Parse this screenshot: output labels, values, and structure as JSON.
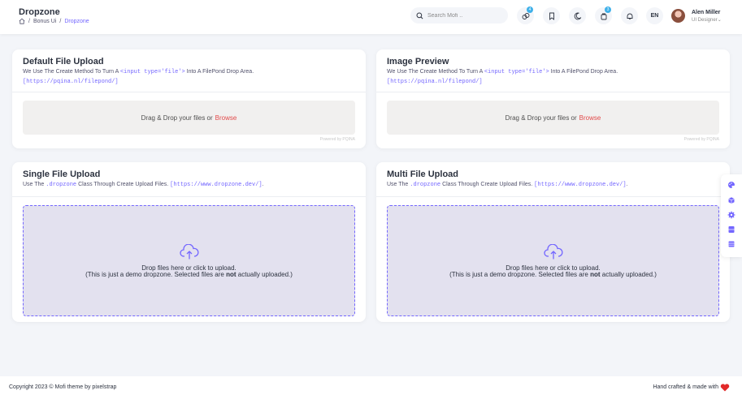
{
  "header": {
    "title": "Dropzone",
    "breadcrumb": [
      "Bonus Ui",
      "Dropzone"
    ],
    "search_placeholder": "Search Mofi ..",
    "icons": [
      "collection-icon",
      "bookmark-icon",
      "moon-icon",
      "bag-icon",
      "bell-icon"
    ],
    "badges": {
      "collection": "4",
      "bag": "3"
    },
    "language": "EN",
    "user": {
      "name": "Alen Miller",
      "role": "UI Designer"
    }
  },
  "cards": {
    "default_upload": {
      "title": "Default File Upload",
      "desc_before": "We Use The Create Method To Turn A",
      "desc_code": "<input type='file'>",
      "desc_after": "Into A FilePond Drop Area.",
      "link": "[https://pqina.nl/filepond/]",
      "drop_text": "Drag & Drop your files or",
      "browse": "Browse",
      "powered": "Powered by PQINA"
    },
    "image_preview": {
      "title": "Image Preview",
      "desc_before": "We Use The Create Method To Turn A",
      "desc_code": "<input type='file'>",
      "desc_after": "Into A FilePond Drop Area.",
      "link": "[https://pqina.nl/filepond/]",
      "drop_text": "Drag & Drop your files or",
      "browse": "Browse",
      "powered": "Powered by PQINA"
    },
    "single_upload": {
      "title": "Single File Upload",
      "desc_before": "Use The",
      "desc_code": ".dropzone",
      "desc_after": "Class Through Create Upload Files.",
      "desc_link": "[https://www.dropzone.dev/]",
      "dz_line1": "Drop files here or click to upload.",
      "dz_line2_before": "(This is just a demo dropzone. Selected files are",
      "dz_line2_bold": "not",
      "dz_line2_after": "actually uploaded.)"
    },
    "multi_upload": {
      "title": "Multi File Upload",
      "desc_before": "Use The",
      "desc_code": ".dropzone",
      "desc_after": "Class Through Create Upload Files.",
      "desc_link": "[https://www.dropzone.dev/]",
      "dz_line1": "Drop files here or click to upload.",
      "dz_line2_before": "(This is just a demo dropzone. Selected files are",
      "dz_line2_bold": "not",
      "dz_line2_after": "actually uploaded.)"
    }
  },
  "side_tools": [
    "palette-icon",
    "box-icon",
    "gear-icon",
    "server-icon",
    "layers-icon"
  ],
  "footer": {
    "copyright": "Copyright 2023 © Mofi theme by pixelstrap",
    "crafted": "Hand crafted & made with"
  },
  "colors": {
    "accent": "#7366ff",
    "browse": "#e24a4a",
    "heart": "#e22a2a"
  }
}
